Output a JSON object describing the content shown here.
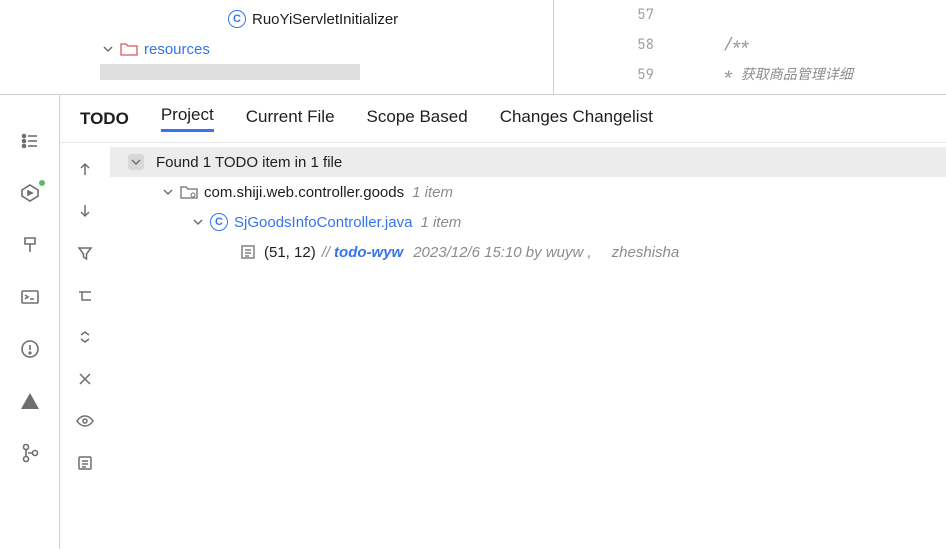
{
  "tree": {
    "class_name": "RuoYiServletInitializer",
    "resources_label": "resources"
  },
  "editor": {
    "line_numbers": [
      "57",
      "58",
      "59"
    ],
    "lines": [
      "/**",
      " *   获取商品管理详细"
    ]
  },
  "panel": {
    "title": "TODO",
    "tabs": [
      "Project",
      "Current File",
      "Scope Based",
      "Changes Changelist"
    ],
    "active_tab": 0,
    "summary": "Found 1 TODO item in 1 file",
    "package": "com.shiji.web.controller.goods",
    "package_count": "1 item",
    "file": "SjGoodsInfoController.java",
    "file_count": "1 item",
    "location": "(51, 12)",
    "slashes": "//",
    "todo_tag": "todo-wyw",
    "meta": "2023/12/6 15:10 by wuyw ,",
    "extra": "zheshisha"
  }
}
